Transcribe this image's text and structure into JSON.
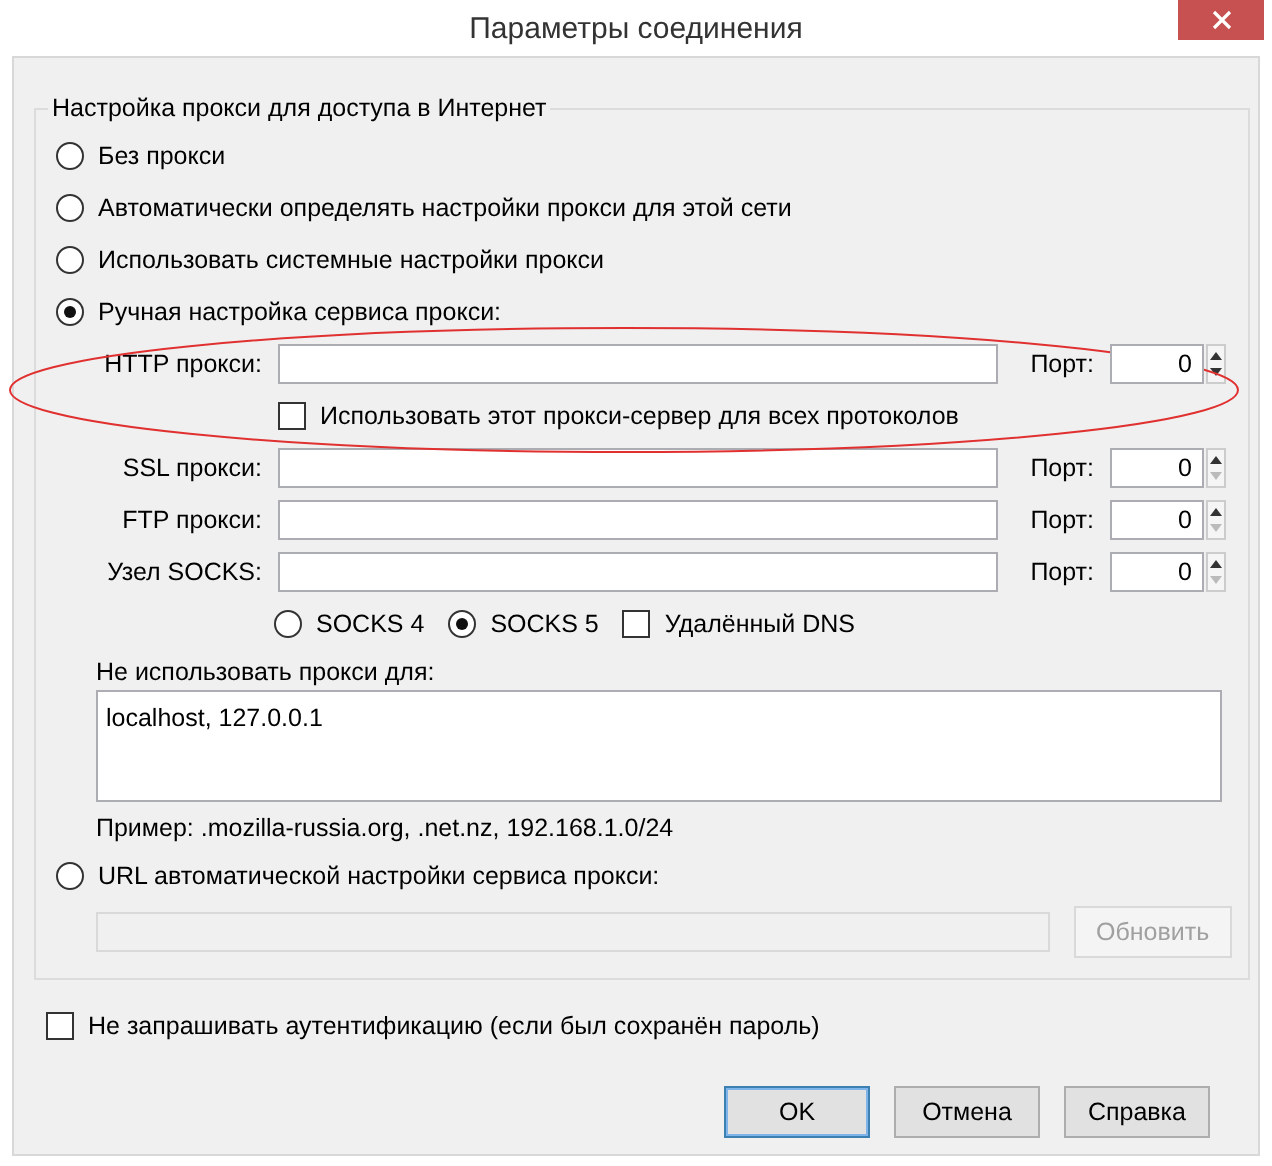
{
  "window": {
    "title": "Параметры соединения"
  },
  "proxy_group": {
    "title": "Настройка прокси для доступа в Интернет",
    "modes": [
      {
        "label": "Без прокси",
        "selected": false
      },
      {
        "label": "Автоматически определять настройки прокси для этой сети",
        "selected": false
      },
      {
        "label": "Использовать системные настройки прокси",
        "selected": false
      },
      {
        "label": "Ручная настройка сервиса прокси:",
        "selected": true
      }
    ],
    "proxies": [
      {
        "label": "HTTP прокси:",
        "port_label": "Порт:",
        "port": "0"
      },
      {
        "label": "SSL прокси:",
        "port_label": "Порт:",
        "port": "0"
      },
      {
        "label": "FTP прокси:",
        "port_label": "Порт:",
        "port": "0"
      },
      {
        "label": "Узел SOCKS:",
        "port_label": "Порт:",
        "port": "0"
      }
    ],
    "use_for_all": {
      "label": "Использовать этот прокси-сервер для всех протоколов",
      "checked": false
    },
    "socks_versions": [
      {
        "label": "SOCKS 4",
        "selected": false
      },
      {
        "label": "SOCKS 5",
        "selected": true
      }
    ],
    "remote_dns": {
      "label": "Удалённый DNS",
      "checked": false
    },
    "no_proxy": {
      "label": "Не использовать прокси для:",
      "value": "localhost, 127.0.0.1",
      "example": "Пример: .mozilla-russia.org, .net.nz, 192.168.1.0/24"
    },
    "auto_url": {
      "label": "URL автоматической настройки сервиса прокси:",
      "selected": false,
      "disabled": true,
      "button": "Обновить"
    }
  },
  "auth_checkbox": {
    "label": "Не запрашивать аутентификацию (если был сохранён пароль)",
    "checked": false
  },
  "buttons": [
    {
      "label": "OK",
      "default": true
    },
    {
      "label": "Отмена",
      "default": false
    },
    {
      "label": "Справка",
      "default": false
    }
  ]
}
